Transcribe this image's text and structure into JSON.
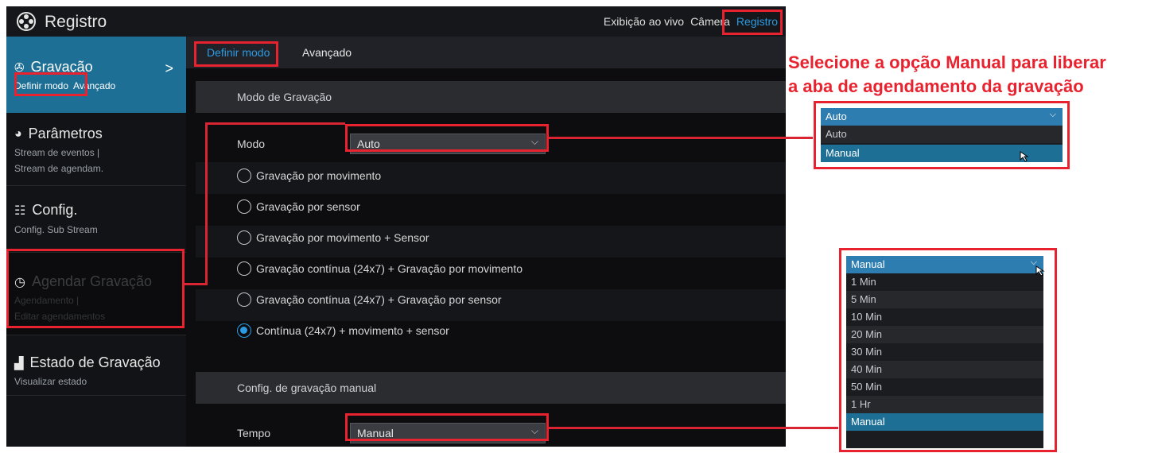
{
  "app": {
    "title": "Registro"
  },
  "topnav": {
    "live": "Exibição ao vivo",
    "camera": "Câmera",
    "registro": "Registro"
  },
  "sidebar": {
    "gravacao": {
      "label": "Gravação",
      "sub_definir": "Definir modo",
      "sub_avancado": "Avançado"
    },
    "parametros": {
      "label": "Parâmetros",
      "sub1": "Stream de eventos |",
      "sub2": "Stream de agendam."
    },
    "config": {
      "label": "Config.",
      "sub1": "Config. Sub Stream"
    },
    "agendar": {
      "label": "Agendar Gravação",
      "sub1": "Agendamento |",
      "sub2": "Editar agendamentos"
    },
    "estado": {
      "label": "Estado de Gravação",
      "sub1": "Visualizar estado"
    }
  },
  "tabs": {
    "definir": "Definir modo",
    "avancado": "Avançado"
  },
  "modo_section": {
    "title": "Modo de Gravação",
    "modo_label": "Modo",
    "modo_value": "Auto",
    "options": [
      "Gravação por movimento",
      "Gravação por sensor",
      "Gravação por movimento + Sensor",
      "Gravação contínua (24x7) + Gravação por movimento",
      "Gravação contínua (24x7) + Gravação por sensor",
      "Contínua (24x7) + movimento + sensor"
    ],
    "selected_index": 5
  },
  "manual_section": {
    "title": "Config. de gravação manual",
    "tempo_label": "Tempo",
    "tempo_value": "Manual"
  },
  "annotation": "Selecione a opção Manual para liberar\na aba de agendamento da gravação",
  "popup_modo": {
    "header": "Auto",
    "options": [
      "Auto",
      "Manual"
    ]
  },
  "popup_tempo": {
    "header": "Manual",
    "options": [
      "1 Min",
      "5 Min",
      "10 Min",
      "20 Min",
      "30 Min",
      "40 Min",
      "50 Min",
      "1 Hr",
      "Manual"
    ]
  },
  "colors": {
    "accent": "#2b9be2",
    "highlight": "#e8232f",
    "sidebar_active": "#1e6f95"
  }
}
